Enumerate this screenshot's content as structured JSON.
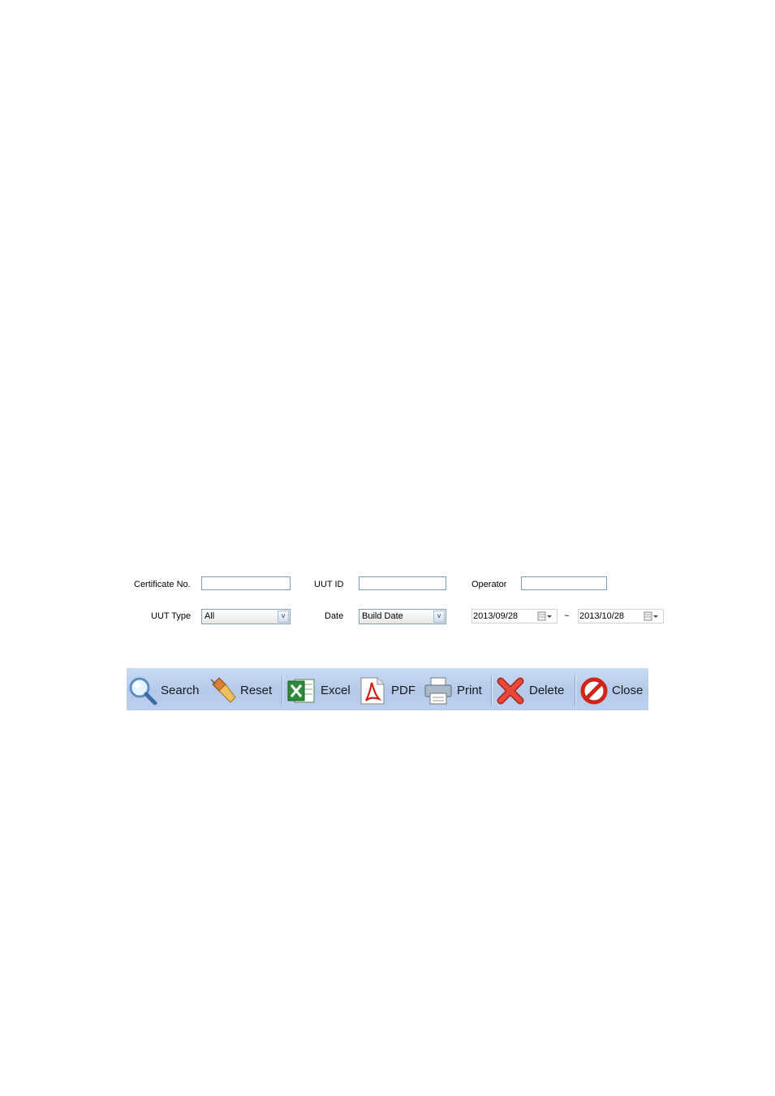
{
  "form": {
    "certificate_label": "Certificate No.",
    "certificate_value": "",
    "uut_id_label": "UUT ID",
    "uut_id_value": "",
    "operator_label": "Operator",
    "operator_value": "",
    "uut_type_label": "UUT Type",
    "uut_type_value": "All",
    "date_label": "Date",
    "date_value": "Build Date",
    "date_from": "2013/09/28",
    "date_separator": "~",
    "date_to": "2013/10/28"
  },
  "toolbar": {
    "search_label": "Search",
    "reset_label": "Reset",
    "excel_label": "Excel",
    "pdf_label": "PDF",
    "print_label": "Print",
    "delete_label": "Delete",
    "close_label": "Close"
  },
  "colors": {
    "toolbar_bg": "#bcd0ee",
    "field_border": "#7b9ebd"
  }
}
